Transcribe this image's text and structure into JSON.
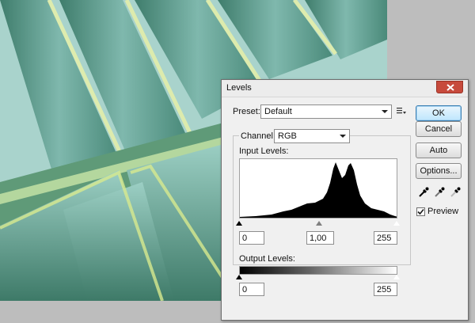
{
  "dialog": {
    "title": "Levels",
    "preset_label": "Preset:",
    "preset_value": "Default",
    "channel_label": "Channel:",
    "channel_value": "RGB",
    "input_levels_label": "Input Levels:",
    "input_black": "0",
    "input_gamma": "1,00",
    "input_white": "255",
    "output_levels_label": "Output Levels:",
    "output_black": "0",
    "output_white": "255",
    "buttons": {
      "ok": "OK",
      "cancel": "Cancel",
      "auto": "Auto",
      "options": "Options..."
    },
    "preview_label": "Preview",
    "preview_checked": true,
    "icons": [
      "close-icon",
      "preset-options-icon",
      "black-eyedropper-icon",
      "gray-eyedropper-icon",
      "white-eyedropper-icon"
    ]
  },
  "colors": {
    "close_button": "#c74a3c",
    "primary_button_border": "#3c7fb1",
    "dialog_bg": "#f0f0f0",
    "histogram_fill": "#000000"
  }
}
